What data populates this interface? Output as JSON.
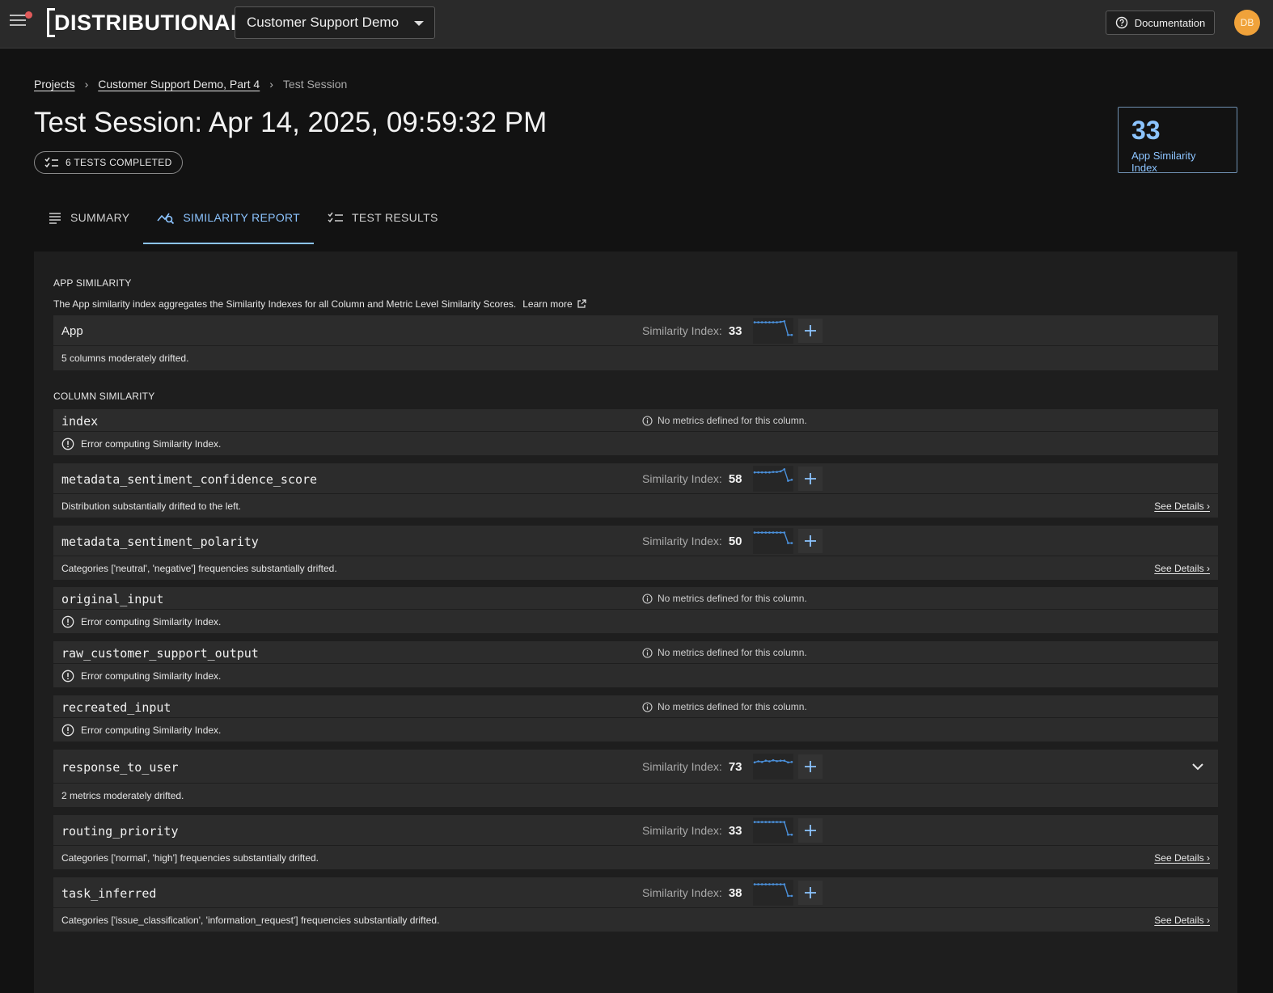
{
  "topbar": {
    "logo": "DISTRIBUTIONAL",
    "project_select": "Customer Support Demo",
    "documentation_label": "Documentation",
    "avatar_initials": "DB"
  },
  "breadcrumb": {
    "projects": "Projects",
    "project": "Customer Support Demo, Part 4",
    "current": "Test Session"
  },
  "page": {
    "title": "Test Session: Apr 14, 2025, 09:59:32 PM",
    "tests_badge": "6 TESTS COMPLETED",
    "app_similarity_value": "33",
    "app_similarity_label": "App Similarity Index"
  },
  "tabs": [
    {
      "label": "SUMMARY",
      "icon": "list-icon"
    },
    {
      "label": "SIMILARITY REPORT",
      "icon": "chart-search-icon",
      "active": true
    },
    {
      "label": "TEST RESULTS",
      "icon": "checklist-icon"
    }
  ],
  "app_section": {
    "heading": "APP SIMILARITY",
    "description": "The App similarity index aggregates the Similarity Indexes for all Column and Metric Level Similarity Scores.",
    "learn_more": "Learn more"
  },
  "column_section": {
    "heading": "COLUMN SIMILARITY"
  },
  "labels": {
    "similarity_index": "Similarity Index:",
    "no_metrics": "No metrics defined for this column.",
    "error": "Error computing Similarity Index.",
    "see_details": "See Details ›"
  },
  "app_row": {
    "name": "App",
    "value": "33",
    "note": "5 columns moderately drifted.",
    "spark": [
      0.9,
      0.9,
      0.9,
      0.9,
      0.9,
      0.9,
      0.9,
      0.92,
      0.95,
      0.3,
      0.3
    ]
  },
  "rows": [
    {
      "name": "index",
      "type": "error"
    },
    {
      "name": "metadata_sentiment_confidence_score",
      "type": "metric",
      "value": "58",
      "note": "Distribution substantially drifted to the left.",
      "details": true,
      "spark": [
        0.8,
        0.8,
        0.8,
        0.8,
        0.8,
        0.82,
        0.82,
        0.85,
        0.95,
        0.4,
        0.45
      ]
    },
    {
      "name": "metadata_sentiment_polarity",
      "type": "metric",
      "value": "50",
      "note": "Categories ['neutral', 'negative'] frequencies substantially drifted.",
      "details": true,
      "spark": [
        0.9,
        0.9,
        0.9,
        0.9,
        0.9,
        0.9,
        0.9,
        0.9,
        0.9,
        0.4,
        0.4
      ]
    },
    {
      "name": "original_input",
      "type": "error"
    },
    {
      "name": "raw_customer_support_output",
      "type": "error"
    },
    {
      "name": "recreated_input",
      "type": "error"
    },
    {
      "name": "response_to_user",
      "type": "metric",
      "value": "73",
      "note": "2 metrics moderately drifted.",
      "details": false,
      "expand": true,
      "spark": [
        0.7,
        0.75,
        0.72,
        0.78,
        0.75,
        0.8,
        0.76,
        0.78,
        0.78,
        0.7,
        0.72
      ]
    },
    {
      "name": "routing_priority",
      "type": "metric",
      "value": "33",
      "note": "Categories ['normal', 'high'] frequencies substantially drifted.",
      "details": true,
      "spark": [
        0.9,
        0.9,
        0.9,
        0.9,
        0.9,
        0.9,
        0.9,
        0.9,
        0.9,
        0.3,
        0.3
      ]
    },
    {
      "name": "task_inferred",
      "type": "metric",
      "value": "38",
      "note": "Categories ['issue_classification', 'information_request'] frequencies substantially drifted.",
      "details": true,
      "spark": [
        0.9,
        0.9,
        0.9,
        0.9,
        0.9,
        0.9,
        0.9,
        0.9,
        0.9,
        0.35,
        0.35
      ]
    }
  ],
  "colors": {
    "accent": "#8cc4ff",
    "spark_line": "#4a8fd9",
    "avatar": "#f0a23a",
    "notify_dot": "#e05a5a"
  }
}
